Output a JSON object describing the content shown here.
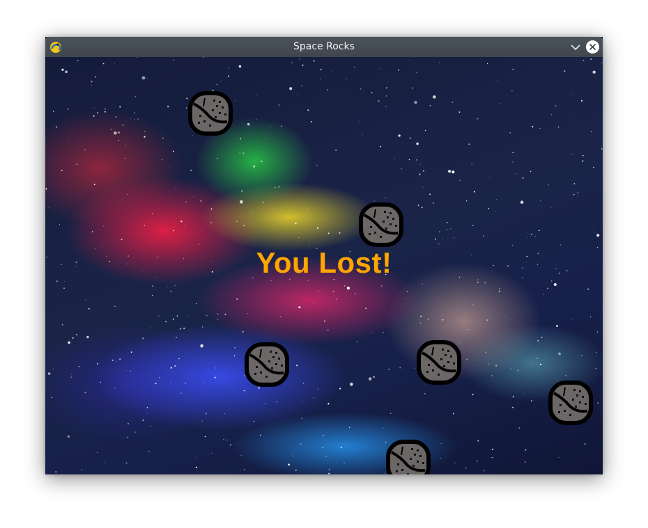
{
  "window": {
    "title": "Space Rocks",
    "app_icon": "pygame-snake-icon",
    "buttons": {
      "minimize": "chevron-down-icon",
      "close": "close-icon"
    }
  },
  "game": {
    "message": "You Lost!",
    "message_color": "#ffa500",
    "rock_count": 6
  }
}
